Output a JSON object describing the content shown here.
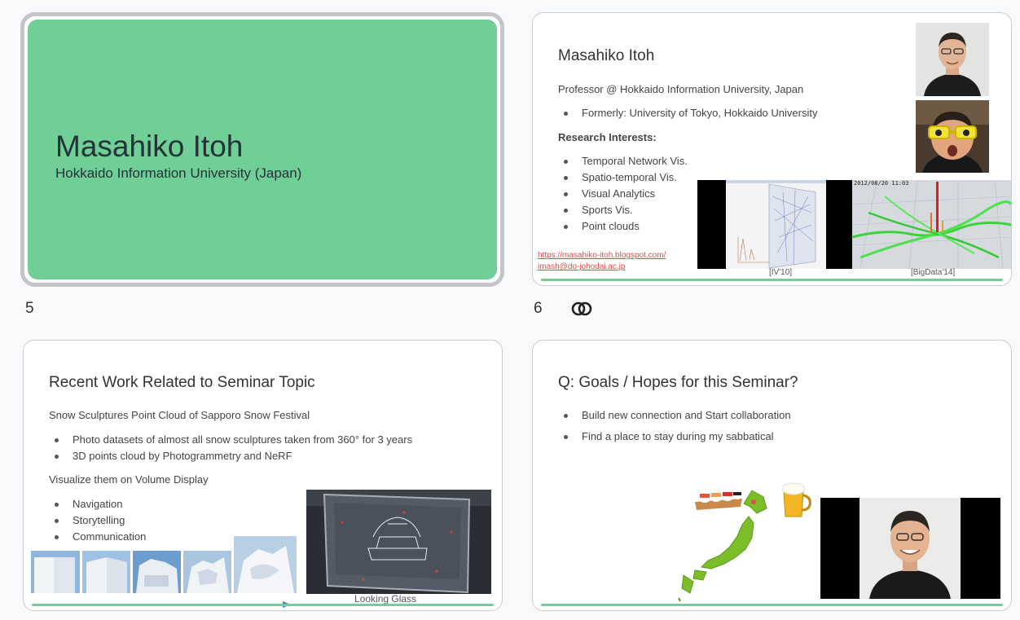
{
  "slides": {
    "s5": {
      "number": "5",
      "title": "Masahiko Itoh",
      "subtitle": "Hokkaido Information University (Japan)",
      "bg_color": "#6fcf97"
    },
    "s6": {
      "number": "6",
      "title": "Masahiko Itoh",
      "affiliation": "Professor @ Hokkaido Information University, Japan",
      "formerly": [
        "Formerly: University of Tokyo, Hokkaido University"
      ],
      "interests_heading": "Research Interests:",
      "interests": [
        "Temporal Network Vis.",
        "Spatio-temporal Vis.",
        "Visual Analytics",
        "Sports Vis.",
        "Point clouds"
      ],
      "link_blog": "https://masahiko-itoh.blogspot.com/",
      "link_mail": "imash@do-johodai.ac.jp",
      "caption_left": "[IV'10]",
      "caption_right": "[BigData'14]",
      "timestamp": "2012/08/20  11:03"
    },
    "s7": {
      "title": "Recent Work Related to Seminar Topic",
      "intro": "Snow Sculptures Point Cloud of Sapporo Snow Festival",
      "bullets1": [
        "Photo datasets of almost all snow sculptures taken from 360° for 3 years",
        "3D points cloud by Photogrammetry and NeRF"
      ],
      "visualize": "Visualize them on Volume Display",
      "bullets2": [
        "Navigation",
        "Storytelling",
        "Communication"
      ],
      "caption": "Looking Glass"
    },
    "s8": {
      "title": "Q: Goals / Hopes for this Seminar?",
      "bullets": [
        "Build new connection and Start collaboration",
        "Find a place to stay during my sabbatical"
      ]
    }
  },
  "icons": {
    "link": "link-icon"
  }
}
